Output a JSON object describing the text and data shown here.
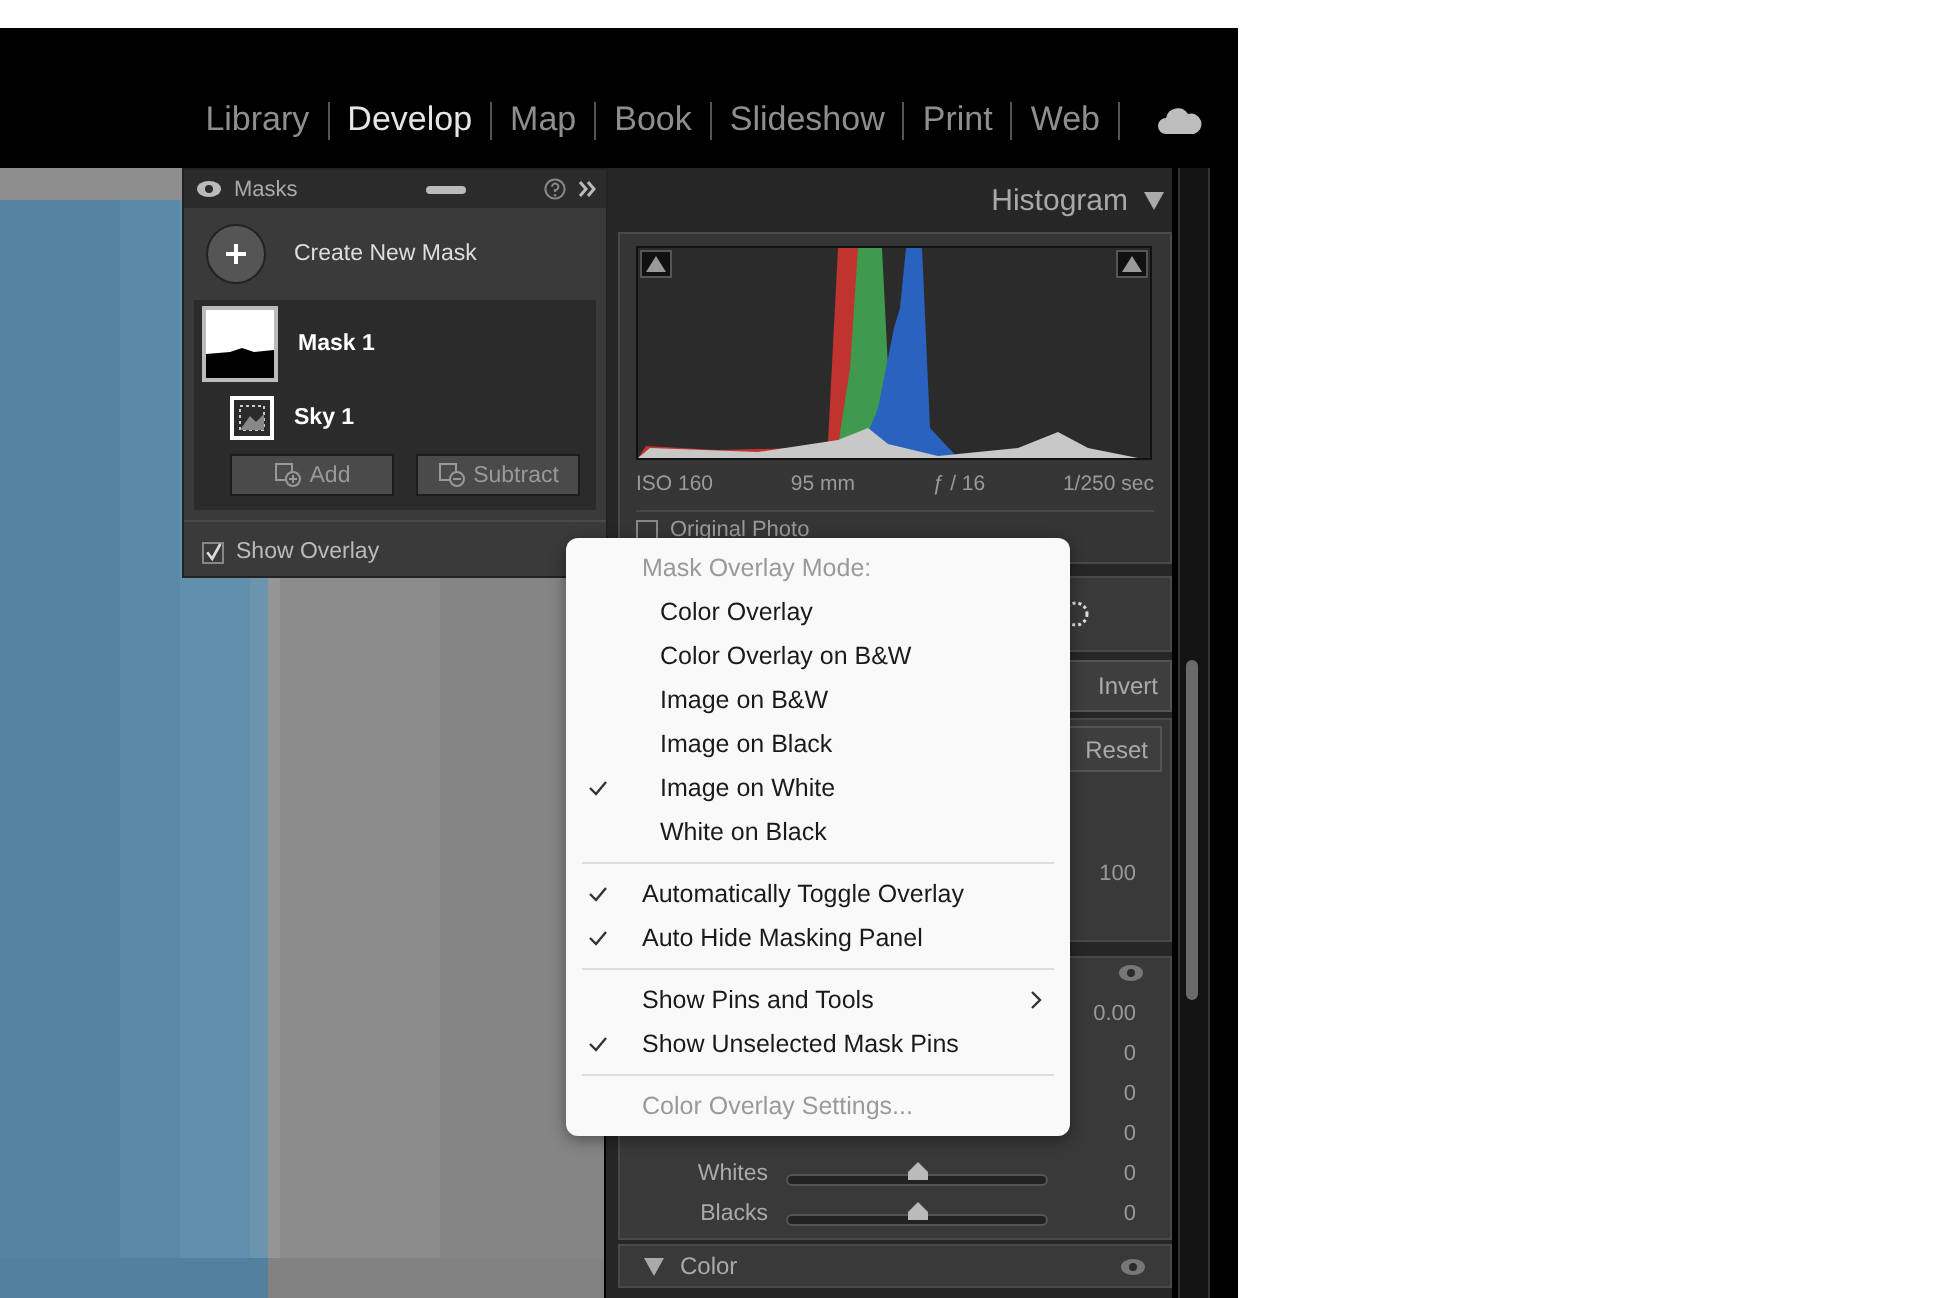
{
  "nav": {
    "items": [
      {
        "label": "Library",
        "selected": false
      },
      {
        "label": "Develop",
        "selected": true
      },
      {
        "label": "Map",
        "selected": false
      },
      {
        "label": "Book",
        "selected": false
      },
      {
        "label": "Slideshow",
        "selected": false
      },
      {
        "label": "Print",
        "selected": false
      },
      {
        "label": "Web",
        "selected": false
      }
    ]
  },
  "masks_panel": {
    "title": "Masks",
    "create_label": "Create New Mask",
    "masks": [
      {
        "name": "Mask 1",
        "components": [
          {
            "name": "Sky 1"
          }
        ]
      }
    ],
    "buttons": [
      {
        "label": "Add",
        "kind": "add"
      },
      {
        "label": "Subtract",
        "kind": "subtract"
      }
    ],
    "show_overlay": {
      "label": "Show Overlay",
      "checked": true
    }
  },
  "histogram": {
    "title": "Histogram",
    "info": [
      "ISO 160",
      "95 mm",
      "ƒ / 16",
      "1/250 sec"
    ],
    "original_photo": {
      "label": "Original Photo",
      "checked": false
    }
  },
  "panel": {
    "invert_label": "Invert",
    "reset_label": "Reset",
    "amount": "100",
    "adjustments": [
      {
        "value": "0.00"
      },
      {
        "value": "0"
      },
      {
        "value": "0"
      },
      {
        "value": "0"
      },
      {
        "label": "Whites",
        "value": "0",
        "level": 0.5
      },
      {
        "label": "Blacks",
        "value": "0",
        "level": 0.5
      }
    ],
    "color_section": {
      "title": "Color",
      "expanded": true
    }
  },
  "menu": {
    "items": [
      {
        "kind": "header",
        "label": "Mask Overlay Mode:",
        "checked": false,
        "disabled": true
      },
      {
        "kind": "mode",
        "label": "Color Overlay",
        "checked": false,
        "disabled": false
      },
      {
        "kind": "mode",
        "label": "Color Overlay on B&W",
        "checked": false,
        "disabled": false
      },
      {
        "kind": "mode",
        "label": "Image on B&W",
        "checked": false,
        "disabled": false
      },
      {
        "kind": "mode",
        "label": "Image on Black",
        "checked": false,
        "disabled": false
      },
      {
        "kind": "mode",
        "label": "Image on White",
        "checked": true,
        "disabled": false
      },
      {
        "kind": "mode",
        "label": "White on Black",
        "checked": false,
        "disabled": false
      },
      {
        "kind": "separator"
      },
      {
        "kind": "option",
        "label": "Automatically Toggle Overlay",
        "checked": true,
        "disabled": false
      },
      {
        "kind": "option",
        "label": "Auto Hide Masking Panel",
        "checked": true,
        "disabled": false
      },
      {
        "kind": "separator"
      },
      {
        "kind": "submenu",
        "label": "Show Pins and Tools",
        "checked": false,
        "disabled": false
      },
      {
        "kind": "option",
        "label": "Show Unselected Mask Pins",
        "checked": true,
        "disabled": false
      },
      {
        "kind": "separator"
      },
      {
        "kind": "option",
        "label": "Color Overlay Settings...",
        "checked": false,
        "disabled": true
      }
    ]
  }
}
